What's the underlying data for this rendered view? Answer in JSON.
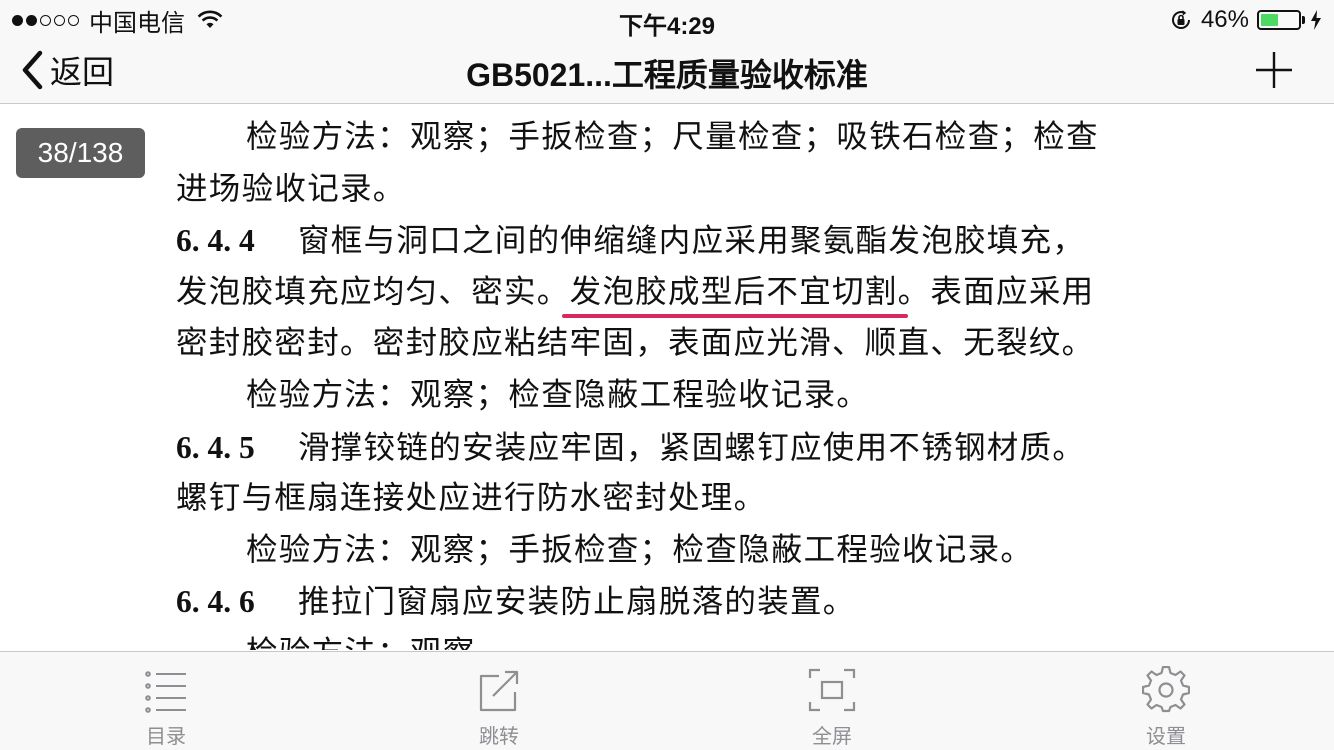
{
  "status_bar": {
    "carrier": "中国电信",
    "time": "下午4:29",
    "battery": "46%",
    "battery_level": 0.46
  },
  "nav": {
    "back_label": "返回",
    "title": "GB5021...工程质量验收标准"
  },
  "page_indicator": "38/138",
  "document": {
    "p1_line1": "检验方法：观察；手扳检查；尺量检查；吸铁石检查；检查",
    "p1_line2": "进场验收记录。",
    "c644_num": "6. 4. 4",
    "c644_line1": "窗框与洞口之间的伸缩缝内应采用聚氨酯发泡胶填充，",
    "c644_line2_a": "发泡胶填充应均匀、密实。",
    "c644_line2_highlight": "发泡胶成型后不宜切割",
    "c644_line2_b": "。表面应采用",
    "c644_line3": "密封胶密封。密封胶应粘结牢固，表面应光滑、顺直、无裂纹。",
    "c644_check": "检验方法：观察；检查隐蔽工程验收记录。",
    "c645_num": "6. 4. 5",
    "c645_line1": "滑撑铰链的安装应牢固，紧固螺钉应使用不锈钢材质。",
    "c645_line2": "螺钉与框扇连接处应进行防水密封处理。",
    "c645_check": "检验方法：观察；手扳检查；检查隐蔽工程验收记录。",
    "c646_num": "6. 4. 6",
    "c646_line1": "推拉门窗扇应安装防止扇脱落的装置。",
    "c646_check": "检验方法：观察。"
  },
  "toolbar": {
    "toc_label": "目录",
    "jump_label": "跳转",
    "fullscreen_label": "全屏",
    "settings_label": "设置"
  },
  "colors": {
    "highlight_underline": "#d8285c",
    "battery_green": "#4cd964",
    "badge_bg": "#5e5e5e",
    "toolbar_icon": "#8e8e93"
  }
}
